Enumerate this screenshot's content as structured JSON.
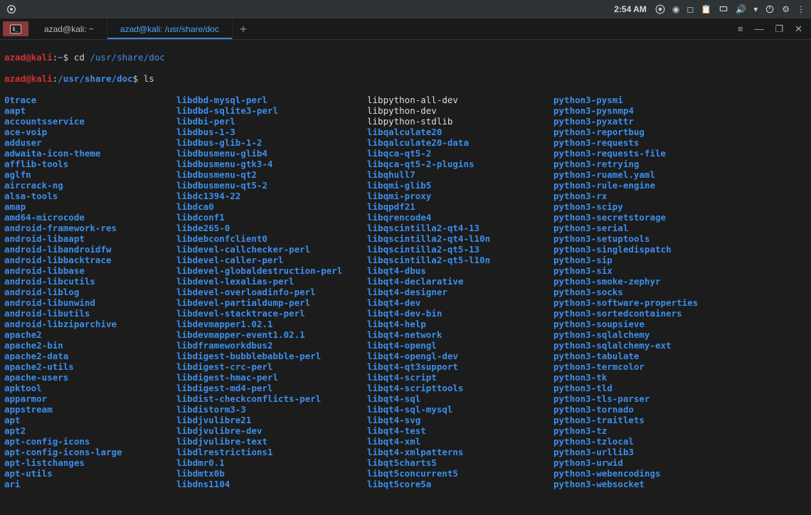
{
  "topbar": {
    "time": "2:54 AM"
  },
  "tabs": {
    "tab1": "azad@kali: ~",
    "tab2": "azad@kali: /usr/share/doc",
    "newtab": "+"
  },
  "window_controls": {
    "menu": "≡",
    "min": "—",
    "max": "❐",
    "close": "✕"
  },
  "prompt1": {
    "user": "azad@kali",
    "sep": ":",
    "path": "~",
    "dollar": "$",
    "cmd": "cd ",
    "arg": "/usr/share/doc"
  },
  "prompt2": {
    "user": "azad@kali",
    "sep": ":",
    "path": "/usr/share/doc",
    "dollar": "$",
    "cmd": "ls"
  },
  "listing": {
    "col1": [
      "0trace",
      "aapt",
      "accountsservice",
      "ace-voip",
      "adduser",
      "adwaita-icon-theme",
      "afflib-tools",
      "aglfn",
      "aircrack-ng",
      "alsa-tools",
      "amap",
      "amd64-microcode",
      "android-framework-res",
      "android-libaapt",
      "android-libandroidfw",
      "android-libbacktrace",
      "android-libbase",
      "android-libcutils",
      "android-liblog",
      "android-libunwind",
      "android-libutils",
      "android-libziparchive",
      "apache2",
      "apache2-bin",
      "apache2-data",
      "apache2-utils",
      "apache-users",
      "apktool",
      "apparmor",
      "appstream",
      "apt",
      "apt2",
      "apt-config-icons",
      "apt-config-icons-large",
      "apt-listchanges",
      "apt-utils",
      "ari"
    ],
    "col2": [
      "libdbd-mysql-perl",
      "libdbd-sqlite3-perl",
      "libdbi-perl",
      "libdbus-1-3",
      "libdbus-glib-1-2",
      "libdbusmenu-glib4",
      "libdbusmenu-gtk3-4",
      "libdbusmenu-qt2",
      "libdbusmenu-qt5-2",
      "libdc1394-22",
      "libdca0",
      "libdconf1",
      "libde265-0",
      "libdebconfclient0",
      "libdevel-callchecker-perl",
      "libdevel-caller-perl",
      "libdevel-globaldestruction-perl",
      "libdevel-lexalias-perl",
      "libdevel-overloadinfo-perl",
      "libdevel-partialdump-perl",
      "libdevel-stacktrace-perl",
      "libdevmapper1.02.1",
      "libdevmapper-event1.02.1",
      "libdframeworkdbus2",
      "libdigest-bubblebabble-perl",
      "libdigest-crc-perl",
      "libdigest-hmac-perl",
      "libdigest-md4-perl",
      "libdist-checkconflicts-perl",
      "libdistorm3-3",
      "libdjvulibre21",
      "libdjvulibre-dev",
      "libdjvulibre-text",
      "libdlrestrictions1",
      "libdmr0.1",
      "libdmtx0b",
      "libdns1104"
    ],
    "col3": [
      "libpython-all-dev",
      "libpython-dev",
      "libpython-stdlib",
      "libqalculate20",
      "libqalculate20-data",
      "libqca-qt5-2",
      "libqca-qt5-2-plugins",
      "libqhull7",
      "libqmi-glib5",
      "libqmi-proxy",
      "libqpdf21",
      "libqrencode4",
      "libqscintilla2-qt4-13",
      "libqscintilla2-qt4-l10n",
      "libqscintilla2-qt5-13",
      "libqscintilla2-qt5-l10n",
      "libqt4-dbus",
      "libqt4-declarative",
      "libqt4-designer",
      "libqt4-dev",
      "libqt4-dev-bin",
      "libqt4-help",
      "libqt4-network",
      "libqt4-opengl",
      "libqt4-opengl-dev",
      "libqt4-qt3support",
      "libqt4-script",
      "libqt4-scripttools",
      "libqt4-sql",
      "libqt4-sql-mysql",
      "libqt4-svg",
      "libqt4-test",
      "libqt4-xml",
      "libqt4-xmlpatterns",
      "libqt5charts5",
      "libqt5concurrent5",
      "libqt5core5a"
    ],
    "col3_white_indices": [
      0,
      1,
      2
    ],
    "col4": [
      "python3-pysmi",
      "python3-pysnmp4",
      "python3-pyxattr",
      "python3-reportbug",
      "python3-requests",
      "python3-requests-file",
      "python3-retrying",
      "python3-ruamel.yaml",
      "python3-rule-engine",
      "python3-rx",
      "python3-scipy",
      "python3-secretstorage",
      "python3-serial",
      "python3-setuptools",
      "python3-singledispatch",
      "python3-sip",
      "python3-six",
      "python3-smoke-zephyr",
      "python3-socks",
      "python3-software-properties",
      "python3-sortedcontainers",
      "python3-soupsieve",
      "python3-sqlalchemy",
      "python3-sqlalchemy-ext",
      "python3-tabulate",
      "python3-termcolor",
      "python3-tk",
      "python3-tld",
      "python3-tls-parser",
      "python3-tornado",
      "python3-traitlets",
      "python3-tz",
      "python3-tzlocal",
      "python3-urllib3",
      "python3-urwid",
      "python3-webencodings",
      "python3-websocket"
    ]
  }
}
